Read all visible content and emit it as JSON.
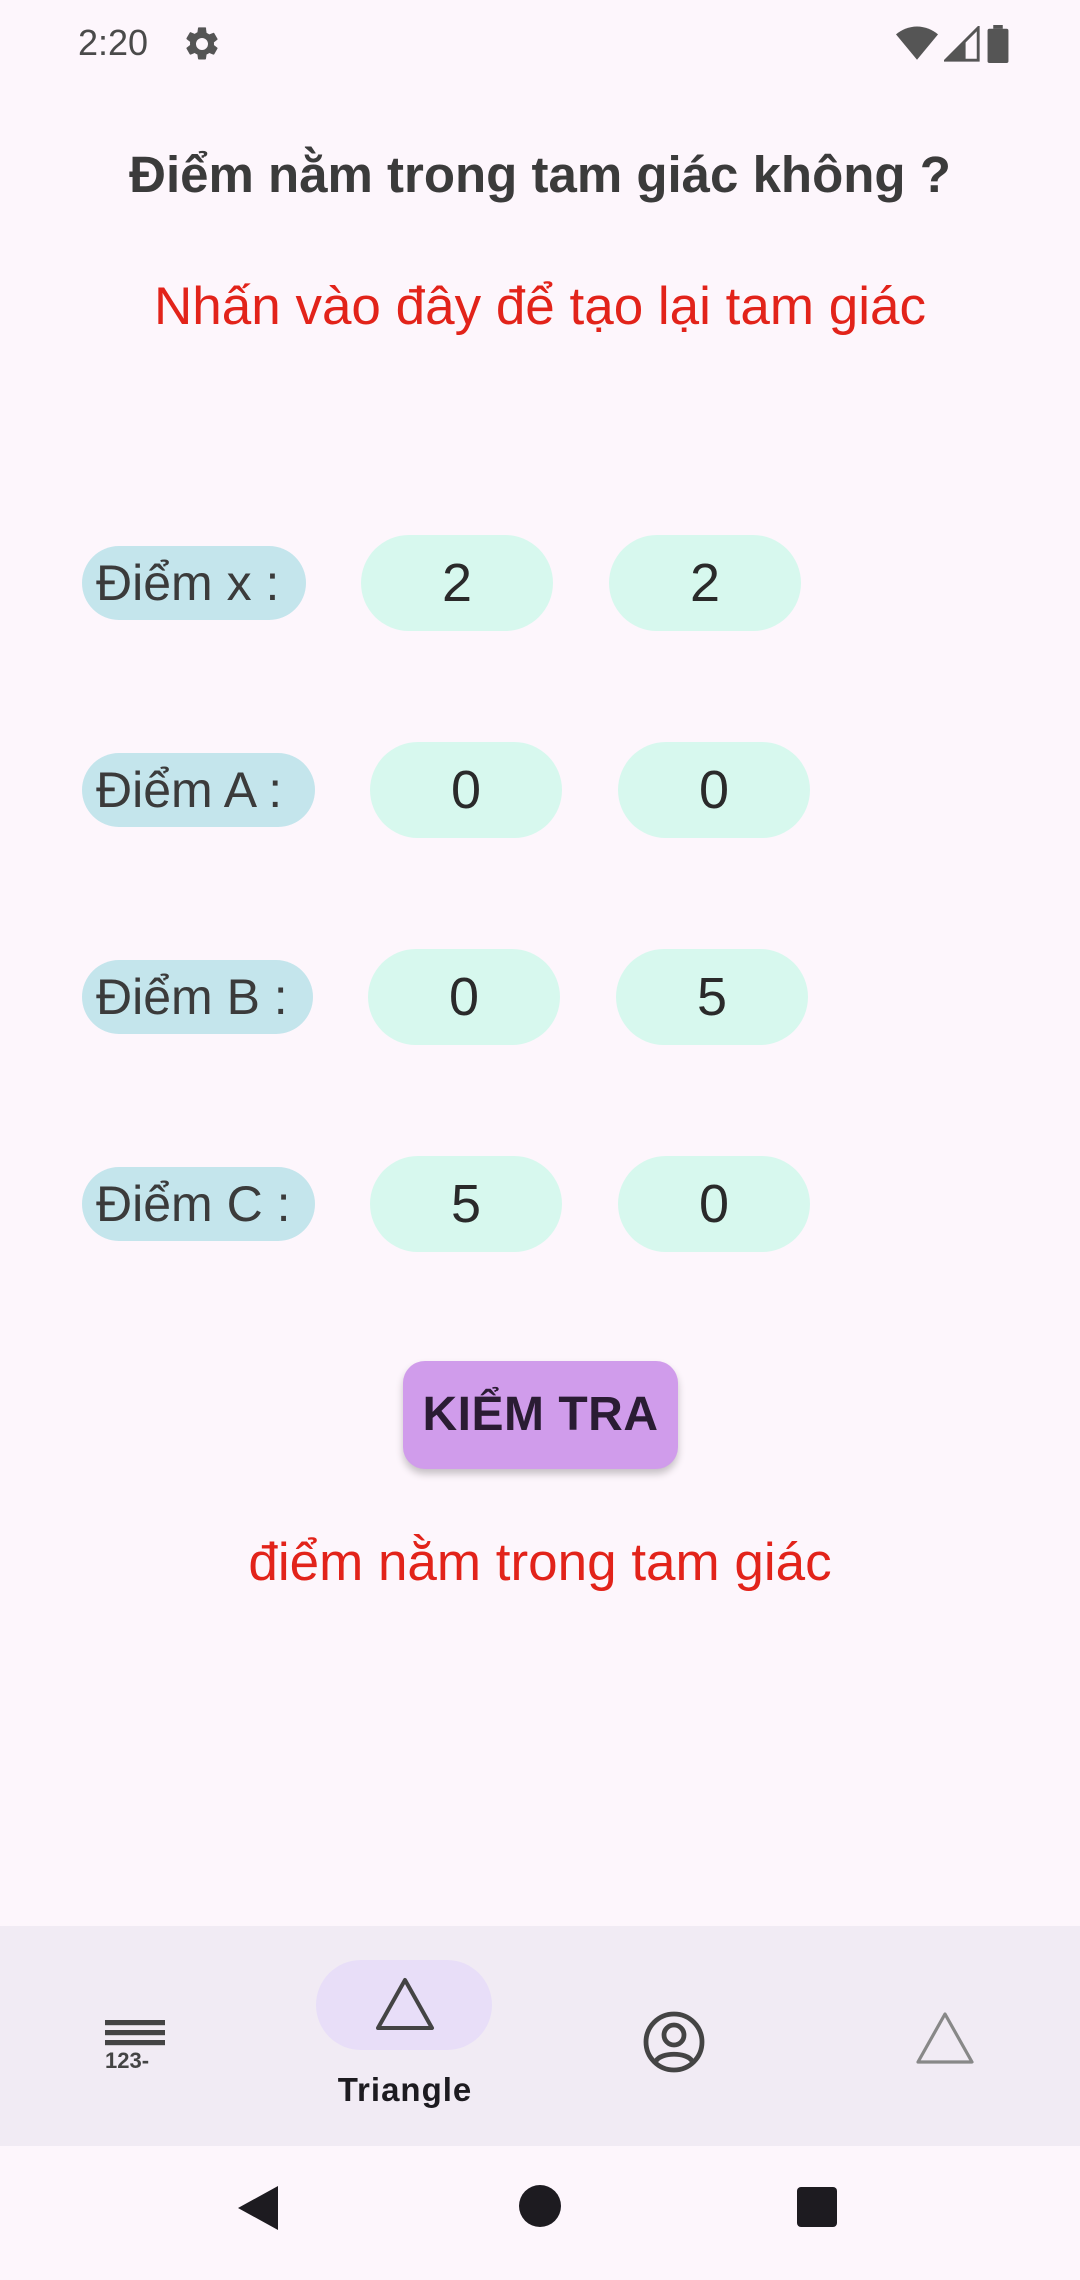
{
  "status_bar": {
    "time": "2:20",
    "icons": [
      "settings-gear-icon",
      "wifi-icon",
      "cell-signal-icon",
      "battery-icon"
    ]
  },
  "page": {
    "title": "Điểm nằm trong tam giác không ?",
    "regen_link": "Nhấn vào đây để tạo lại tam giác",
    "accent_red": "#E2231A"
  },
  "points": [
    {
      "label": "Điểm x :",
      "x": "2",
      "y": "2"
    },
    {
      "label": "Điểm A :",
      "x": "0",
      "y": "0"
    },
    {
      "label": "Điểm B :",
      "x": "0",
      "y": "5"
    },
    {
      "label": "Điểm C :",
      "x": "5",
      "y": "0"
    }
  ],
  "check_button": {
    "label": "KIỂM TRA",
    "color": "#D09CEB"
  },
  "result": {
    "text": "điểm nằm trong tam giác"
  },
  "bottom_nav": {
    "items": [
      {
        "icon": "numbers-list-icon",
        "label": ""
      },
      {
        "icon": "triangle-icon",
        "label": "Triangle",
        "selected": true
      },
      {
        "icon": "account-circle-icon",
        "label": ""
      },
      {
        "icon": "triangle-outline-icon",
        "label": ""
      }
    ]
  },
  "system_nav": {
    "icons": [
      "back-icon",
      "home-icon",
      "recents-icon"
    ]
  }
}
